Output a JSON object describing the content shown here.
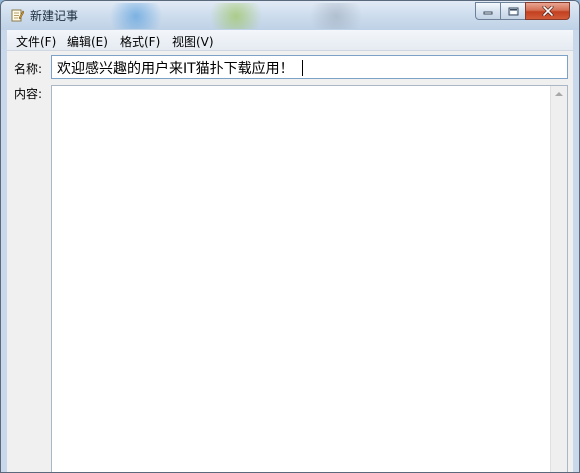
{
  "window": {
    "title": "新建记事",
    "icon": "notepad-icon"
  },
  "controls": {
    "minimize_icon": "minimize-icon",
    "maximize_icon": "maximize-icon",
    "close_icon": "close-icon"
  },
  "menu": {
    "items": [
      {
        "label": "文件(F)"
      },
      {
        "label": "编辑(E)"
      },
      {
        "label": "格式(F)"
      },
      {
        "label": "视图(V)"
      }
    ]
  },
  "form": {
    "name_label": "名称:",
    "name_value": "欢迎感兴趣的用户来IT猫扑下载应用！",
    "content_label": "内容:",
    "content_value": ""
  }
}
